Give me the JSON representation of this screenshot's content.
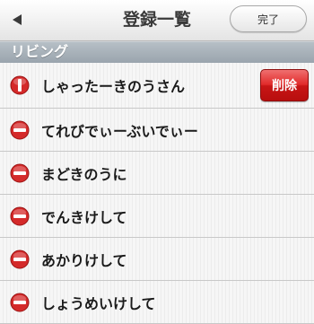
{
  "navbar": {
    "title": "登録一覧",
    "back_icon": "back-arrow-icon",
    "done_label": "完了"
  },
  "section": {
    "title": "リビング"
  },
  "items": [
    {
      "label": "しゃったーきのうさん",
      "delete_confirm": true,
      "delete_label": "削除"
    },
    {
      "label": "てれびでぃーぶいでぃー",
      "delete_confirm": false
    },
    {
      "label": "まどきのうに",
      "delete_confirm": false
    },
    {
      "label": "でんきけして",
      "delete_confirm": false
    },
    {
      "label": "あかりけして",
      "delete_confirm": false
    },
    {
      "label": "しょうめいけして",
      "delete_confirm": false
    }
  ],
  "colors": {
    "minus_red": "#d42a2a",
    "delete_red": "#d21c1c"
  },
  "icons": {
    "row_minus": "minus-circle-icon",
    "row_minus_active": "minus-circle-rotated-icon"
  }
}
